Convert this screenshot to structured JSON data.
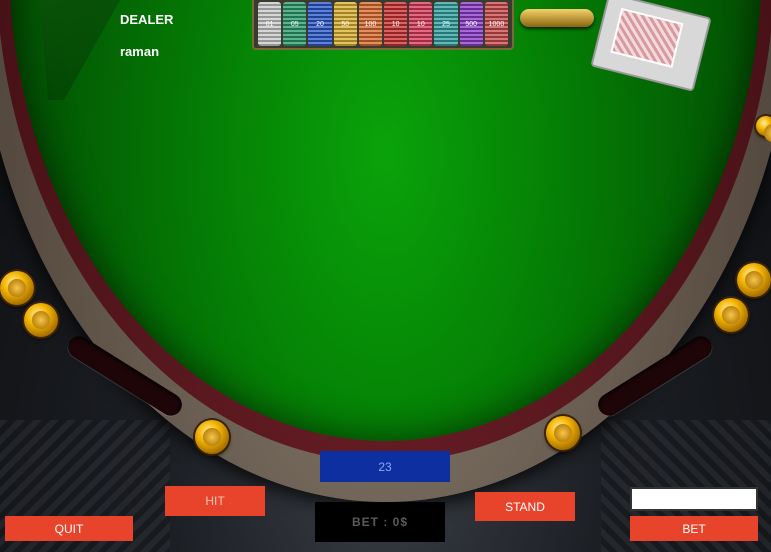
{
  "table": {
    "dealer_label": "DEALER",
    "player_name": "raman",
    "felt_color": "#058205",
    "wood_color": "#4a1218"
  },
  "chip_rack": {
    "chips": [
      {
        "label": "01",
        "color": "#c8c8c8"
      },
      {
        "label": "05",
        "color": "#2a9a6a"
      },
      {
        "label": "20",
        "color": "#2a58c8"
      },
      {
        "label": "50",
        "color": "#d8b030"
      },
      {
        "label": "100",
        "color": "#d86a30"
      },
      {
        "label": "10",
        "color": "#c83030"
      },
      {
        "label": "10",
        "color": "#d83a5a"
      },
      {
        "label": "25",
        "color": "#30a0a0"
      },
      {
        "label": "500",
        "color": "#8a3ac8"
      },
      {
        "label": "1000",
        "color": "#c84a4a"
      }
    ]
  },
  "score": {
    "value": "23"
  },
  "bet": {
    "display": "BET : 0$",
    "input_value": ""
  },
  "buttons": {
    "hit": "HIT",
    "stand": "STAND",
    "quit": "QUIT",
    "bet": "BET"
  },
  "colors": {
    "button": "#e8442c",
    "score_box": "#0e2fa0",
    "bet_display": "#000000"
  }
}
